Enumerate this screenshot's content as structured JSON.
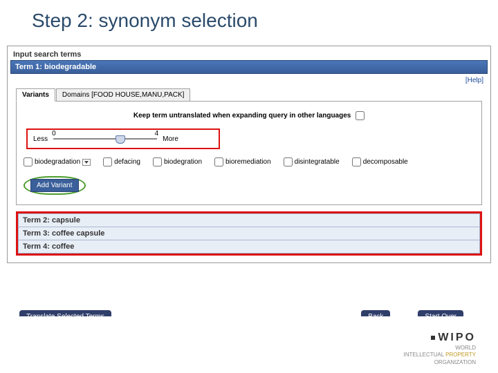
{
  "slide": {
    "title": "Step 2: synonym selection"
  },
  "inputSection": {
    "label": "Input search terms"
  },
  "term1": {
    "barLabel": "Term 1: biodegradable"
  },
  "help": {
    "label": "[Help]"
  },
  "tabs": {
    "variants": "Variants",
    "domains": "Domains [FOOD HOUSE,MANU,PACK]"
  },
  "keepUntranslated": {
    "label": "Keep term untranslated when expanding query in other languages"
  },
  "slider": {
    "lessLabel": "Less",
    "moreLabel": "More",
    "min": "0",
    "max": "4"
  },
  "synonyms": {
    "s0": "biodegradation",
    "s1": "defacing",
    "s2": "biodegration",
    "s3": "bioremediation",
    "s4": "disintegratable",
    "s5": "decomposable"
  },
  "addVariant": {
    "label": "Add Variant"
  },
  "termRows": {
    "t2": "Term 2: capsule",
    "t3": "Term 3: coffee capsule",
    "t4": "Term 4: coffee"
  },
  "actions": {
    "translate": "Translate Selected Terms",
    "back": "Back",
    "startOver": "Start Over"
  },
  "footer": {
    "brand": "WIPO",
    "line1": "WORLD",
    "line2a": "INTELLECTUAL",
    "line2b": " PROPERTY",
    "line3": "ORGANIZATION"
  }
}
